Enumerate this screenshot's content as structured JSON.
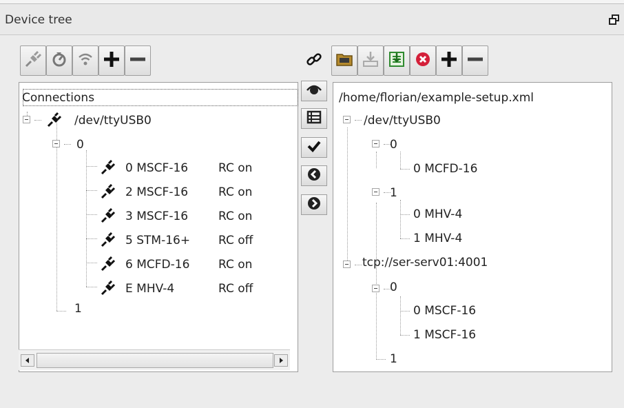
{
  "panel": {
    "title": "Device tree"
  },
  "left_toolbar": [
    "plug-icon",
    "refresh-icon",
    "wireless-icon",
    "plus-icon",
    "minus-icon"
  ],
  "right_toolbar": [
    "link-icon",
    "open-folder-icon",
    "save-icon",
    "apply-icon",
    "close-red-icon",
    "plus-icon",
    "minus-icon"
  ],
  "middle_toolbar": [
    "eye-icon",
    "list-icon",
    "check-icon",
    "arrow-left-icon",
    "arrow-right-icon"
  ],
  "connections_tree": {
    "root": "Connections",
    "port": "/dev/ttyUSB0",
    "bus0": "0",
    "devices": [
      {
        "id": "0 MSCF-16",
        "rc": "RC on"
      },
      {
        "id": "2 MSCF-16",
        "rc": "RC on"
      },
      {
        "id": "3 MSCF-16",
        "rc": "RC on"
      },
      {
        "id": "5 STM-16+",
        "rc": "RC off"
      },
      {
        "id": "6 MCFD-16",
        "rc": "RC on"
      },
      {
        "id": "E MHV-4",
        "rc": "RC off"
      }
    ],
    "bus1": "1"
  },
  "setup_tree": {
    "file": "/home/florian/example-setup.xml",
    "conn1": "/dev/ttyUSB0",
    "conn1_bus0": "0",
    "conn1_bus0_dev0": "0 MCFD-16",
    "conn1_bus1": "1",
    "conn1_bus1_dev0": "0 MHV-4",
    "conn1_bus1_dev1": "1 MHV-4",
    "conn2": "tcp://ser-serv01:4001",
    "conn2_bus0": "0",
    "conn2_bus0_dev0": "0 MSCF-16",
    "conn2_bus0_dev1": "1 MSCF-16",
    "conn2_bus1": "1"
  }
}
